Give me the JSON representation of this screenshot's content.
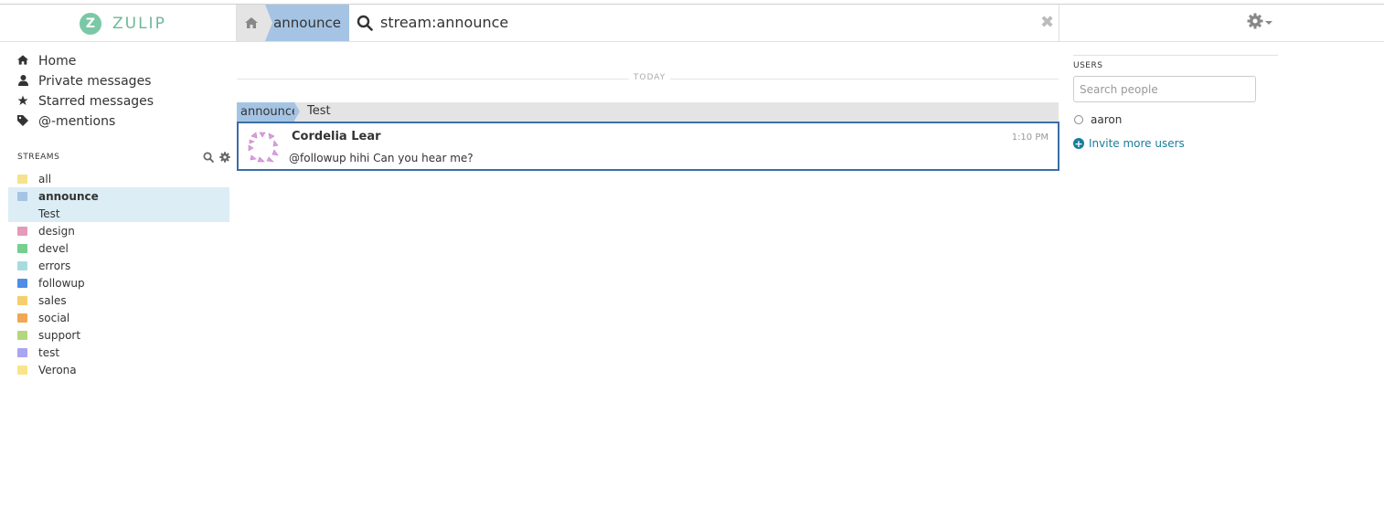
{
  "brand": {
    "logo_letter": "Z",
    "name": "ZULIP"
  },
  "navbar": {
    "home_icon": "home-icon",
    "current_stream": "announce",
    "search_query": "stream:announce",
    "close_symbol": "✖",
    "settings_icon": "gear-icon"
  },
  "left_nav": {
    "items": [
      {
        "label": "Home",
        "icon": "home-icon"
      },
      {
        "label": "Private messages",
        "icon": "user-icon"
      },
      {
        "label": "Starred messages",
        "icon": "star-icon"
      },
      {
        "label": "@-mentions",
        "icon": "tag-icon"
      }
    ]
  },
  "streams": {
    "header": "STREAMS",
    "items": [
      {
        "name": "all",
        "color": "#f5e28c"
      },
      {
        "name": "announce",
        "color": "#a5c4e4",
        "active": true,
        "topics": [
          "Test"
        ]
      },
      {
        "name": "design",
        "color": "#e49ab9"
      },
      {
        "name": "devel",
        "color": "#76ce90"
      },
      {
        "name": "errors",
        "color": "#a6dcdf"
      },
      {
        "name": "followup",
        "color": "#4f8de4"
      },
      {
        "name": "sales",
        "color": "#f5ce6e"
      },
      {
        "name": "social",
        "color": "#f0a855"
      },
      {
        "name": "support",
        "color": "#b4d67d"
      },
      {
        "name": "test",
        "color": "#a9a5f0"
      },
      {
        "name": "Verona",
        "color": "#f8e58a"
      }
    ]
  },
  "messages": {
    "date_separator": "TODAY",
    "recipient": {
      "stream": "announce",
      "topic": "Test"
    },
    "items": [
      {
        "sender": "Cordelia Lear",
        "time": "1:10 PM",
        "content": "@followup hihi Can you hear me?"
      }
    ]
  },
  "right_sidebar": {
    "users_header": "USERS",
    "search_placeholder": "Search people",
    "users": [
      {
        "name": "aaron",
        "status": "offline"
      }
    ],
    "invite_label": "Invite more users"
  }
}
